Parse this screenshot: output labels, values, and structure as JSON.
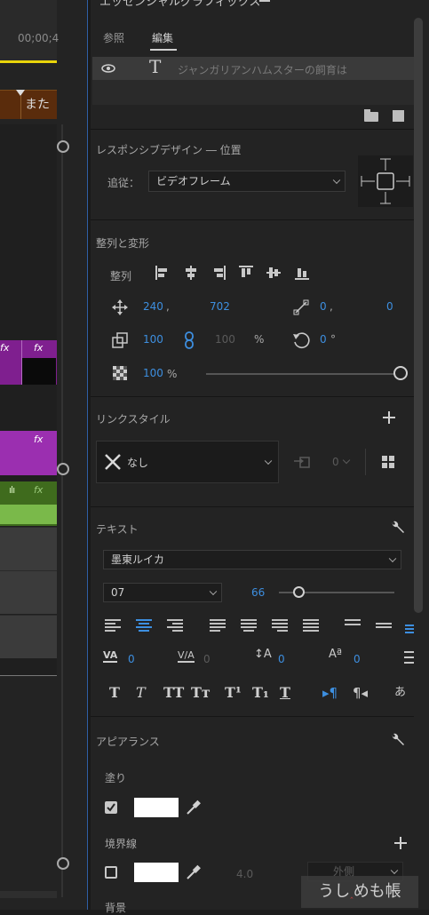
{
  "timeline": {
    "timecode": "00;00;4",
    "marker_text": "また"
  },
  "panel": {
    "title": "エッセンシャルグラフィックス",
    "tabs": [
      {
        "label": "参照"
      },
      {
        "label": "編集"
      }
    ],
    "layer": {
      "text": "ジャンガリアンハムスターの飼育は"
    },
    "responsive": {
      "title": "レスポンシブデザイン ― 位置",
      "follow_label": "追従：",
      "follow_value": "ビデオフレーム"
    },
    "align": {
      "title": "整列と変形",
      "align_label": "整列",
      "position_x": "240",
      "position_sep": ",",
      "position_y": "702",
      "anchor_x": "0",
      "anchor_sep": ",",
      "anchor_y": "0",
      "scale_w": "100",
      "scale_h": "100",
      "scale_unit": "%",
      "rotation": "0",
      "rotation_unit": "°",
      "opacity": "100",
      "opacity_unit": "%",
      "opacity_level": 1.0
    },
    "link_style": {
      "title": "リンクスタイル",
      "value": "なし",
      "count": "0"
    },
    "text": {
      "title": "テキスト",
      "font": "墨東ルイカ",
      "style": "07",
      "size": "66",
      "tracking": "0",
      "kerning": "0",
      "leading": "0",
      "baseline": "0"
    },
    "appearance": {
      "title": "アピアランス",
      "fill_label": "塗り",
      "stroke_label": "境界線",
      "stroke_width": "4.0",
      "stroke_type": "外側",
      "background_label": "背景",
      "fill_color": "#ffffff",
      "stroke_color": "#ffffff"
    }
  },
  "watermark": {
    "text_left": "うし",
    "text_mark": "‸",
    "text_right": "めも帳"
  },
  "colors": {
    "accent": "#3d8fe0",
    "timeline_marker": "#e8d40a",
    "clip": "#9b2fb0",
    "audio": "#7ab94a"
  }
}
